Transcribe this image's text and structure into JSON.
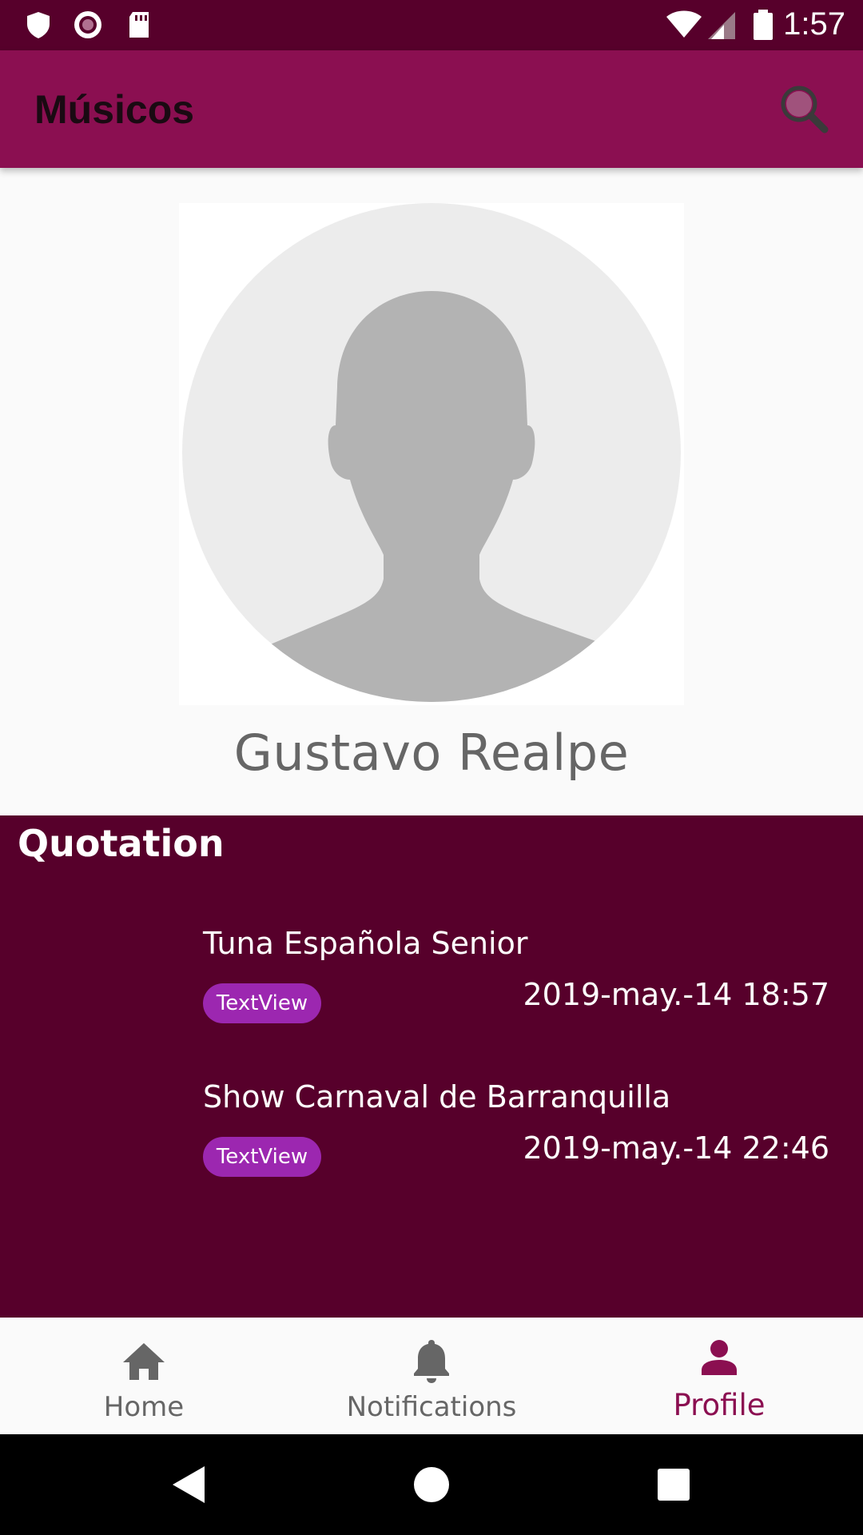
{
  "status_bar": {
    "time": "1:57",
    "icons": [
      "shield-icon",
      "record-icon",
      "sd-card-icon",
      "wifi-icon",
      "signal-icon",
      "battery-icon"
    ]
  },
  "app_bar": {
    "title": "Músicos",
    "search_icon": "search-icon"
  },
  "profile": {
    "name": "Gustavo Realpe",
    "avatar_icon": "default-avatar-icon"
  },
  "quotations": {
    "title": "Quotation",
    "items": [
      {
        "title": "Tuna Española Senior",
        "badge": "TextView",
        "date": "2019-may.-14 18:57"
      },
      {
        "title": "Show Carnaval de Barranquilla",
        "badge": "TextView",
        "date": "2019-may.-14 22:46"
      }
    ]
  },
  "bottom_nav": {
    "items": [
      {
        "label": "Home",
        "icon": "home-icon"
      },
      {
        "label": "Notifications",
        "icon": "bell-icon"
      },
      {
        "label": "Profile",
        "icon": "person-icon",
        "active": true
      }
    ]
  },
  "colors": {
    "status_bar": "#57002b",
    "app_bar": "#8b0f51",
    "panel": "#57002b",
    "badge": "#9c27b0",
    "active_nav": "#8b0f51"
  }
}
